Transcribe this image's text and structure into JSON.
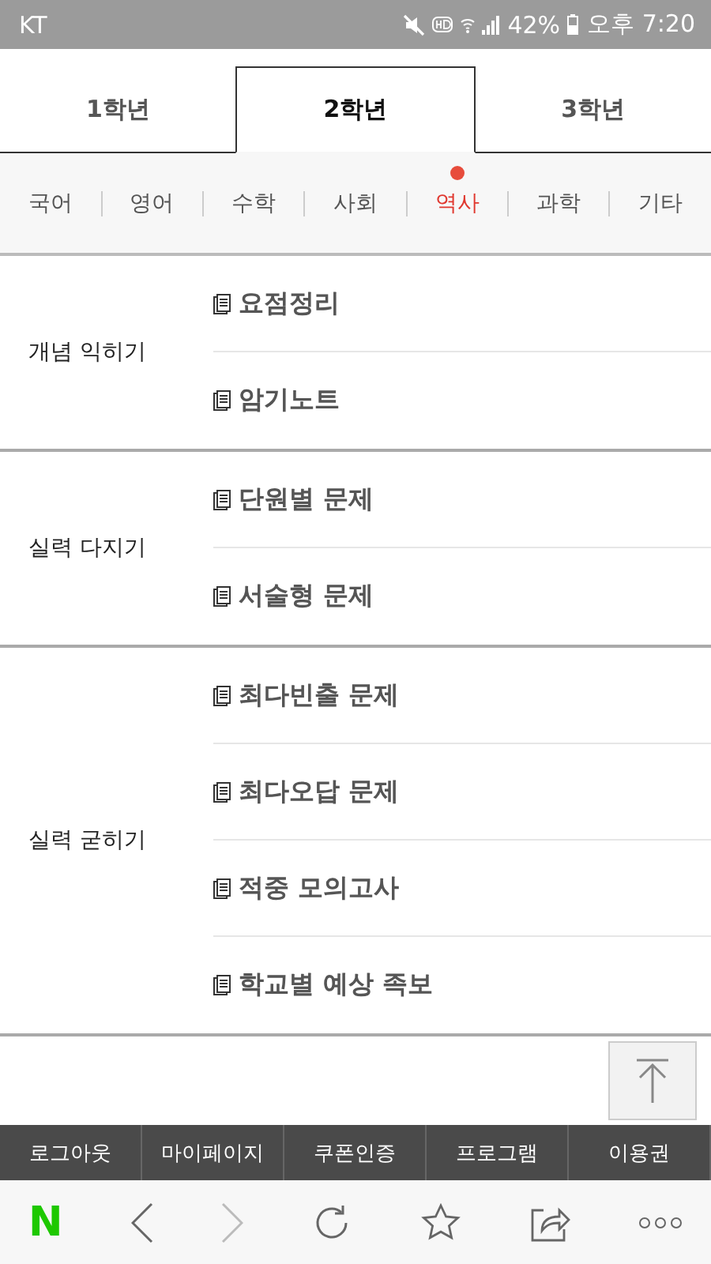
{
  "status_bar": {
    "carrier": "KT",
    "battery": "42%",
    "time": "오후 7:20"
  },
  "grade_tabs": [
    {
      "label": "1학년",
      "selected": false
    },
    {
      "label": "2학년",
      "selected": true
    },
    {
      "label": "3학년",
      "selected": false
    }
  ],
  "subject_tabs": [
    {
      "label": "국어",
      "selected": false
    },
    {
      "label": "영어",
      "selected": false
    },
    {
      "label": "수학",
      "selected": false
    },
    {
      "label": "사회",
      "selected": false
    },
    {
      "label": "역사",
      "selected": true
    },
    {
      "label": "과학",
      "selected": false
    },
    {
      "label": "기타",
      "selected": false
    }
  ],
  "sections": [
    {
      "title": "개념 익히기",
      "items": [
        "요점정리",
        "암기노트"
      ]
    },
    {
      "title": "실력 다지기",
      "items": [
        "단원별 문제",
        "서술형 문제"
      ]
    },
    {
      "title": "실력 굳히기",
      "items": [
        "최다빈출 문제",
        "최다오답 문제",
        "적중 모의고사",
        "학교별 예상 족보"
      ]
    }
  ],
  "footer_menu": [
    "로그아웃",
    "마이페이지",
    "쿠폰인증",
    "프로그램",
    "이용권"
  ],
  "browser_bar": {
    "logo": "N"
  }
}
